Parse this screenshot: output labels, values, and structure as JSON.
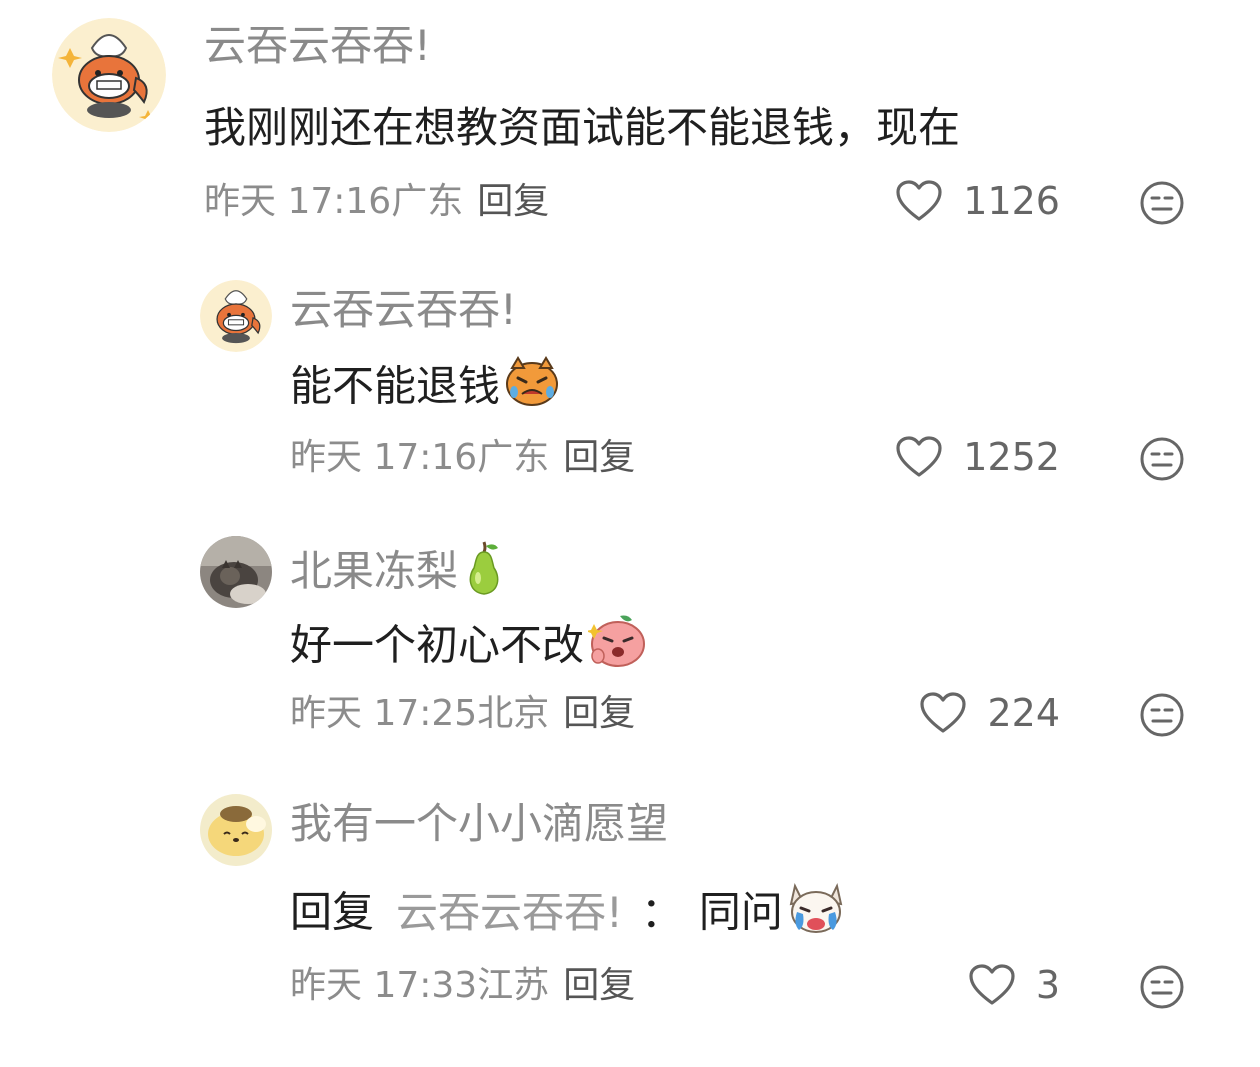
{
  "comments": [
    {
      "username": "云吞云吞吞!",
      "content": "我刚刚还在想教资面试能不能退钱，现在",
      "time": "昨天 17:16",
      "location": "广东",
      "reply_label": "回复",
      "likes": "1126",
      "avatar": "raccoon-chef-avatar"
    },
    {
      "username": "云吞云吞吞!",
      "content": "能不能退钱",
      "emoji": "crying-tiger-emoji",
      "time": "昨天 17:16",
      "location": "广东",
      "reply_label": "回复",
      "likes": "1252",
      "avatar": "raccoon-chef-avatar"
    },
    {
      "username": "北果冻梨",
      "username_emoji": "pear-emoji",
      "content": "好一个初心不改",
      "emoji": "angry-peach-emoji",
      "time": "昨天 17:25",
      "location": "北京",
      "reply_label": "回复",
      "likes": "224",
      "avatar": "cat-photo-avatar"
    },
    {
      "username": "我有一个小小滴愿望",
      "reply_prefix": "回复",
      "reply_to": "云吞云吞吞!",
      "reply_colon": "：",
      "content": "同问",
      "emoji": "crying-dog-emoji",
      "time": "昨天 17:33",
      "location": "江苏",
      "reply_label": "回复",
      "likes": "3",
      "avatar": "pompompurin-avatar"
    }
  ],
  "colors": {
    "username": "#8a8a8a",
    "content": "#1f1f1f",
    "meta": "#8c8c8c",
    "icon": "#666666"
  }
}
